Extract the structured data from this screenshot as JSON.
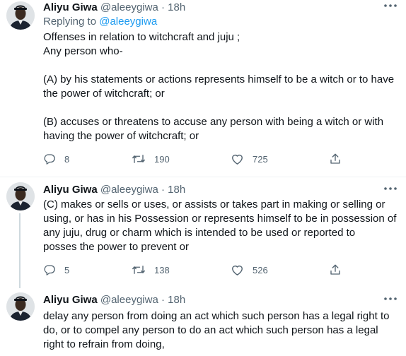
{
  "tweets": [
    {
      "author": "Aliyu Giwa",
      "handle": "@aleeygiwa",
      "time": "18h",
      "reply_prefix": "Replying to",
      "reply_handle": "@aleeygiwa",
      "lines": [
        "Offenses in relation to witchcraft and juju ;",
        "Any person who-",
        "",
        "(A) by his statements or actions represents himself to be a witch or to have",
        "the power of witchcraft; or",
        "",
        "(B) accuses or threatens to accuse any person with being a witch or with",
        "having the power of witchcraft; or"
      ],
      "replies": "8",
      "retweets": "190",
      "likes": "725"
    },
    {
      "author": "Aliyu Giwa",
      "handle": "@aleeygiwa",
      "time": "18h",
      "lines": [
        "(C) makes or sells or uses, or assists or takes part in making or selling or",
        "using, or has in his Possession or represents himself to be in possession of",
        "any juju, drug or charm which is intended to be used or reported to",
        "posses the power to prevent or"
      ],
      "replies": "5",
      "retweets": "138",
      "likes": "526"
    },
    {
      "author": "Aliyu Giwa",
      "handle": "@aleeygiwa",
      "time": "18h",
      "lines": [
        "delay any person from doing an act which such person has a legal right to",
        "do, or to compel any person to do an act which such person has a legal",
        "right to refrain from doing,"
      ]
    }
  ],
  "separator": "·",
  "icons": {
    "more": "more-horizontal-icon",
    "reply": "reply-icon",
    "retweet": "retweet-icon",
    "like": "heart-icon",
    "share": "share-icon"
  },
  "colors": {
    "text": "#0f1419",
    "muted": "#536471",
    "link": "#1d9bf0",
    "divider": "#eff3f4",
    "thread_line": "#cfd9de"
  }
}
